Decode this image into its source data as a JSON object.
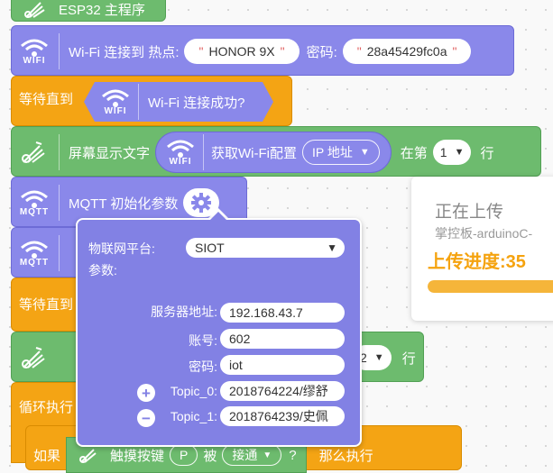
{
  "blocks": {
    "main_label": "ESP32 主程序",
    "wifi_connect": {
      "label": "Wi-Fi 连接到 热点:",
      "ssid": "HONOR 9X",
      "pwd_label": "密码:",
      "password": "28a45429fc0a"
    },
    "wait_until_1": {
      "label": "等待直到",
      "cond": "Wi-Fi 连接成功?"
    },
    "screen_show": {
      "label": "屏幕显示文字",
      "get_config": "获取Wi-Fi配置",
      "option": "IP 地址",
      "at_row": "在第",
      "row_value": "1",
      "row_suffix": "行"
    },
    "mqtt_init": {
      "label": "MQTT 初始化参数"
    },
    "mqtt2_label": "MQTT",
    "wait_until_2": {
      "label": "等待直到"
    },
    "screen_row_value": "2",
    "screen_row_suffix": "行",
    "loop": {
      "label": "循环执行"
    },
    "if_block": {
      "if_label": "如果",
      "touch": "触摸按键",
      "key": "P",
      "is": "被",
      "state": "接通",
      "q": "?",
      "then": "那么执行"
    },
    "wifi_caption": "WIFI",
    "mqtt_caption": "MQTT",
    "glyphs": {
      "quote": "\"",
      "caret": "▼",
      "plus": "+",
      "minus": "−"
    }
  },
  "popup": {
    "platform_label": "物联网平台:",
    "platform_value": "SIOT",
    "params_label": "参数:",
    "server_label": "服务器地址:",
    "server_value": "192.168.43.7",
    "account_label": "账号:",
    "account_value": "602",
    "password_label": "密码:",
    "password_value": "iot",
    "topic0_label": "Topic_0:",
    "topic0_value": "2018764224/缪舒",
    "topic1_label": "Topic_1:",
    "topic1_value": "2018764239/史佩"
  },
  "upload": {
    "title": "正在上传",
    "board": "掌控板-arduinoC-",
    "progress_label": "上传进度:35",
    "progress": 0.35
  },
  "colors": {
    "purple": "#8a88ea",
    "orange": "#f4a414",
    "green": "#6dbb6e",
    "progress": "#f5a30f"
  }
}
